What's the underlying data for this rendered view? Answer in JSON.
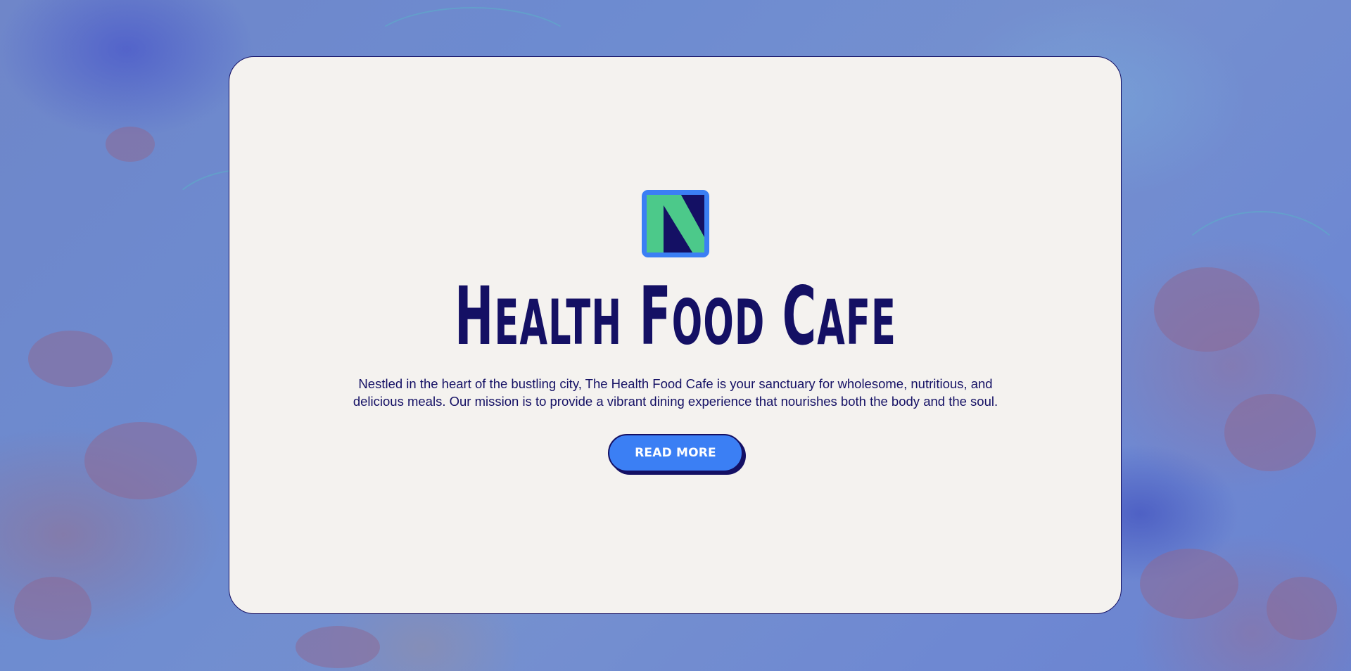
{
  "hero": {
    "title_first_letters": [
      "H",
      "F",
      "C"
    ],
    "title_rest": [
      "EALTH",
      "OOD",
      "AFE"
    ],
    "title_full": "Health Food Cafe",
    "description_line1": "Nestled in the heart of the bustling city, The Health Food Cafe is your sanctuary for wholesome, nutritious, and",
    "description_line2": "delicious meals. Our mission is to provide a vibrant dining experience that nourishes both the body and the soul.",
    "button_label": "READ MORE"
  },
  "logo": {
    "letter": "N",
    "icon": "n-logo-icon"
  },
  "colors": {
    "navy": "#141064",
    "accent_blue": "#3b7ff4",
    "logo_green": "#4cc98a",
    "card_bg": "#f4f2ef"
  }
}
